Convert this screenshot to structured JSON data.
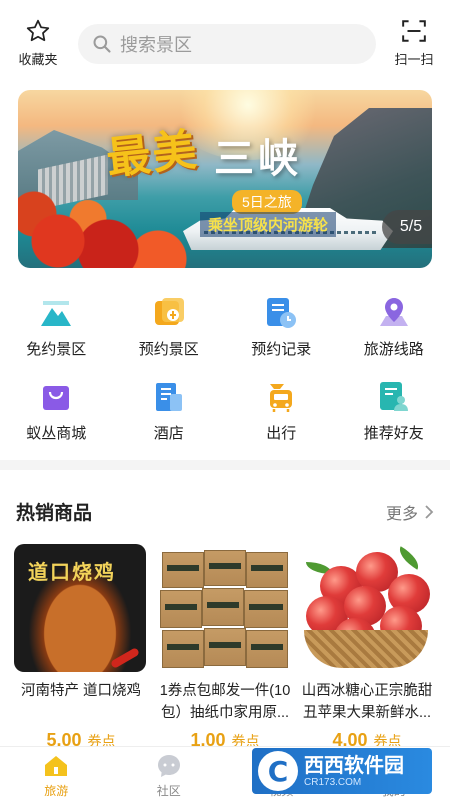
{
  "header": {
    "favorites_label": "收藏夹",
    "search_placeholder": "搜索景区",
    "scan_label": "扫一扫"
  },
  "banner": {
    "title_main": "最美",
    "title_place": "三峡",
    "subtitle_days": "5日之旅",
    "subtitle_cruise": "乘坐顶级内河游轮",
    "counter": "5/5"
  },
  "services": [
    {
      "label": "免约景区",
      "icon": "mountain-icon",
      "color": "#28b6c8"
    },
    {
      "label": "预约景区",
      "icon": "ticket-icon",
      "color": "#f4a81d"
    },
    {
      "label": "预约记录",
      "icon": "record-clock-icon",
      "color": "#3a8fe8"
    },
    {
      "label": "旅游线路",
      "icon": "location-pin-icon",
      "color": "#8a66e0"
    },
    {
      "label": "蚁丛商城",
      "icon": "shopping-bag-icon",
      "color": "#8a5ae6"
    },
    {
      "label": "酒店",
      "icon": "hotel-icon",
      "color": "#3a8fe8"
    },
    {
      "label": "出行",
      "icon": "bus-icon",
      "color": "#f4a81d"
    },
    {
      "label": "推荐好友",
      "icon": "recommend-friend-icon",
      "color": "#28b6b0"
    }
  ],
  "hot": {
    "title": "热销商品",
    "more_label": "更多"
  },
  "products": [
    {
      "name": "河南特产 道口烧鸡",
      "price": "5.00",
      "unit": "券点",
      "image_text": "道口烧鸡"
    },
    {
      "name": "1券点包邮发一件(10包）抽纸巾家用原...",
      "price": "1.00",
      "unit": "券点"
    },
    {
      "name": "山西冰糖心正宗脆甜丑苹果大果新鲜水...",
      "price": "4.00",
      "unit": "券点"
    }
  ],
  "tabs": [
    {
      "label": "旅游",
      "active": true
    },
    {
      "label": "社区",
      "active": false
    },
    {
      "label": "视频",
      "active": false
    },
    {
      "label": "我的",
      "active": false
    }
  ],
  "watermark": {
    "brand": "西西软件园",
    "url": "CR173.COM"
  },
  "colors": {
    "accent": "#e8a114",
    "divider": "#f4f4f4"
  }
}
